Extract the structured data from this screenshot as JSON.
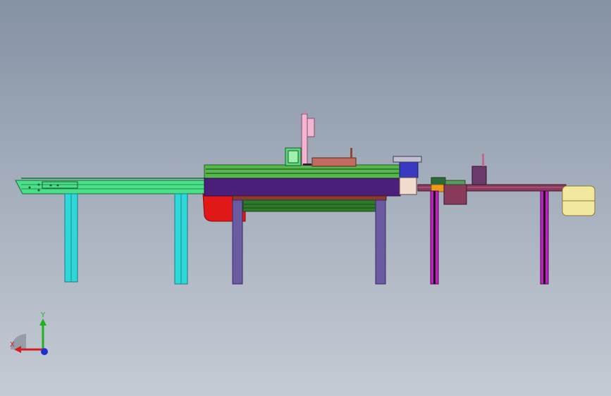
{
  "viewport": {
    "background_top": "#8592a4",
    "background_bottom": "#c5cbd4"
  },
  "triad": {
    "x_label": "X",
    "y_label": "Y",
    "x_color": "#d42020",
    "y_color": "#20b020",
    "z_color": "#2030d0"
  },
  "model": {
    "left_conveyor_color": "#49e08a",
    "left_legs_color": "#2ed8d8",
    "main_frame_color": "#4a1f7a",
    "main_legs_color": "#6a5aa0",
    "red_guard_color": "#e01818",
    "lower_rail_color": "#2f7a2a",
    "gantry_color": "#f2b6d2",
    "right_legs_color": "#c020c0",
    "right_box_color": "#f2e8a0",
    "module_color": "#8a3a5a"
  }
}
